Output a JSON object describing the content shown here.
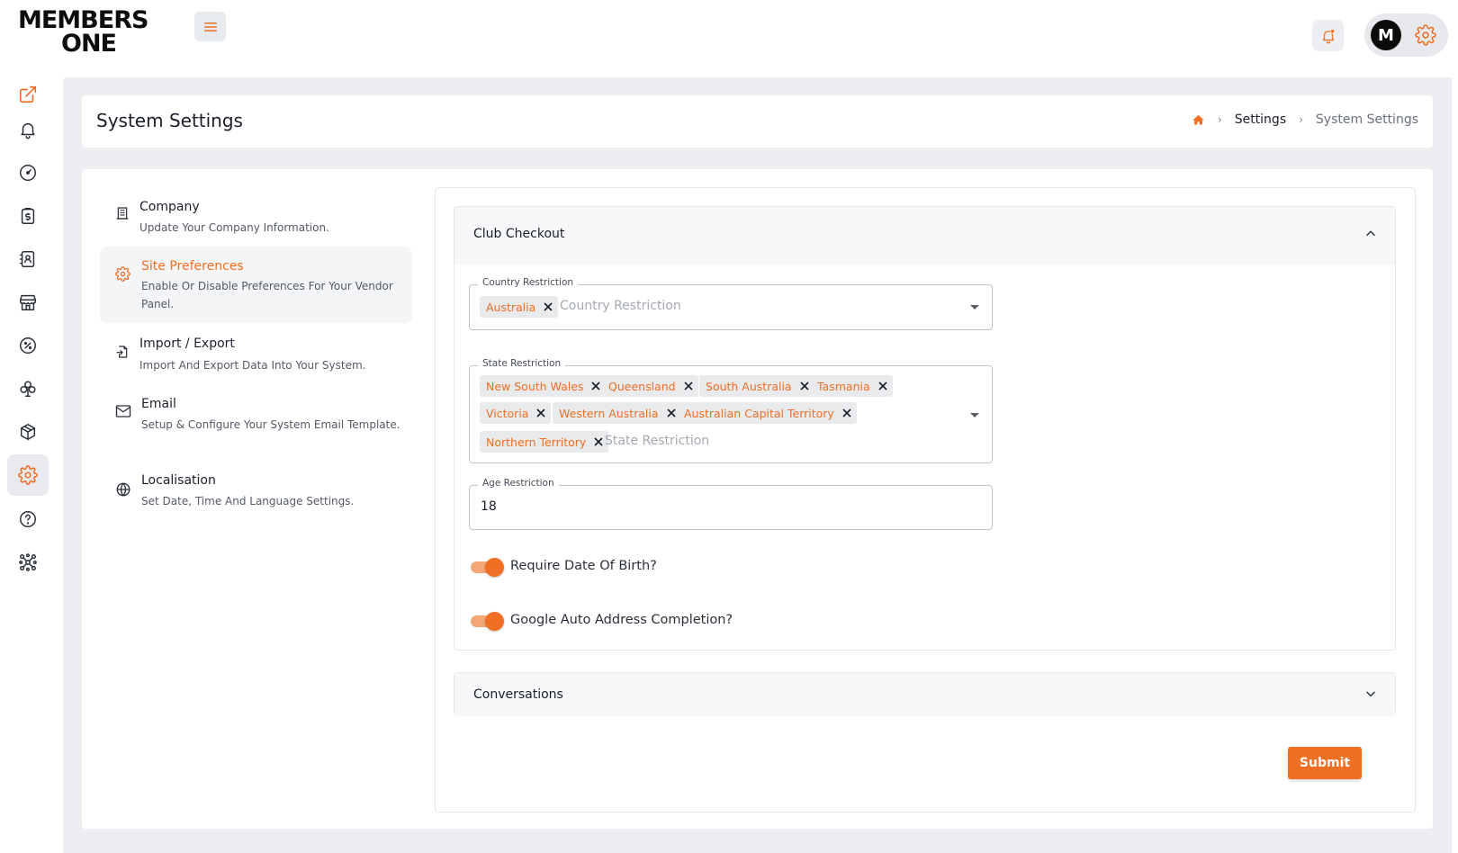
{
  "brand": {
    "logo_line1": "MEMBERS",
    "logo_line2": "ONE",
    "accent": "#ef6f24"
  },
  "topbar": {
    "avatar_initial": "M"
  },
  "sidebar": {
    "items": [
      {
        "icon": "external-link-icon",
        "active": false
      },
      {
        "icon": "bell-icon",
        "active": false
      },
      {
        "icon": "dashboard-icon",
        "active": false
      },
      {
        "icon": "clipboard-dollar-icon",
        "active": false
      },
      {
        "icon": "contacts-book-icon",
        "active": false
      },
      {
        "icon": "store-icon",
        "active": false
      },
      {
        "icon": "discount-icon",
        "active": false
      },
      {
        "icon": "club-icon",
        "active": false
      },
      {
        "icon": "package-icon",
        "active": false
      },
      {
        "icon": "settings-icon",
        "active": true
      },
      {
        "icon": "help-icon",
        "active": false
      },
      {
        "icon": "integrations-icon",
        "active": false
      }
    ]
  },
  "header": {
    "title": "System Settings",
    "breadcrumb": [
      "Settings",
      "System Settings"
    ]
  },
  "settings_nav": [
    {
      "title": "Company",
      "desc": "Update Your Company Information.",
      "icon": "building-icon"
    },
    {
      "title": "Site Preferences",
      "desc": "Enable Or Disable Preferences For Your Vendor Panel.",
      "icon": "gear-icon"
    },
    {
      "title": "Import / Export",
      "desc": "Import And Export Data Into Your System.",
      "icon": "file-import-icon"
    },
    {
      "title": "Email",
      "desc": "Setup & Configure Your System Email Template.",
      "icon": "mail-icon"
    },
    {
      "title": "Localisation",
      "desc": "Set Date, Time And Language Settings.",
      "icon": "globe-icon"
    }
  ],
  "club_checkout": {
    "title": "Club Checkout",
    "country": {
      "label": "Country Restriction",
      "placeholder": "Country Restriction",
      "chips": [
        "Australia"
      ]
    },
    "state": {
      "label": "State Restriction",
      "placeholder": "State Restriction",
      "chips": [
        "New South Wales",
        "Queensland",
        "South Australia",
        "Tasmania",
        "Victoria",
        "Western Australia",
        "Australian Capital Territory",
        "Northern Territory"
      ]
    },
    "age": {
      "label": "Age Restriction",
      "value": "18"
    },
    "toggles": [
      {
        "label": "Require Date Of Birth?",
        "on": true
      },
      {
        "label": "Google Auto Address Completion?",
        "on": true
      }
    ]
  },
  "conversations": {
    "title": "Conversations"
  },
  "submit_label": "Submit"
}
